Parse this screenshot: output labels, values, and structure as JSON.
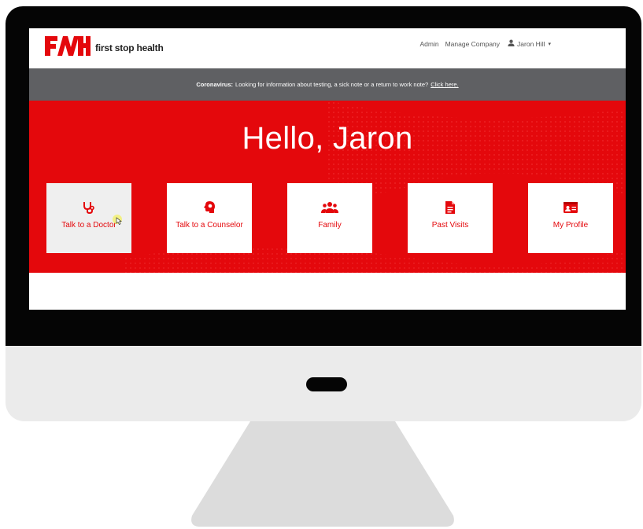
{
  "app": {
    "logo_text": "first stop health",
    "logo_mark": "FSH"
  },
  "nav": {
    "admin": "Admin",
    "manage_company": "Manage Company",
    "user_name": "Jaron Hill"
  },
  "banner": {
    "bold": "Coronavirus:",
    "text": "Looking for information about testing, a sick note or a return to work note?",
    "link": "Click here."
  },
  "hero": {
    "greeting": "Hello, Jaron"
  },
  "cards": [
    {
      "label": "Talk to a Doctor",
      "icon": "stethoscope-icon"
    },
    {
      "label": "Talk to a Counselor",
      "icon": "brain-head-icon"
    },
    {
      "label": "Family",
      "icon": "users-icon"
    },
    {
      "label": "Past Visits",
      "icon": "document-icon"
    },
    {
      "label": "My Profile",
      "icon": "id-card-icon"
    }
  ],
  "colors": {
    "brand_red": "#e4080c",
    "banner_gray": "#5f6063",
    "monitor_black": "#050505",
    "monitor_silver": "#ebebeb"
  }
}
